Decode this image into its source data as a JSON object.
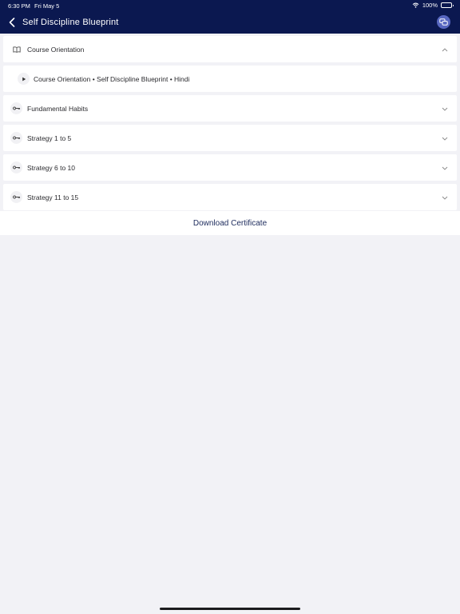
{
  "status_bar": {
    "time": "6:30 PM",
    "date": "Fri May 5",
    "battery": "100%",
    "battery_level": 1.0
  },
  "header": {
    "title": "Self Discipline Blueprint",
    "background": "#0b1850",
    "chat_button_color": "#5867c0"
  },
  "sections": [
    {
      "title": "Course Orientation",
      "icon": "book-icon",
      "expanded": true,
      "lessons": [
        {
          "title": "Course Orientation • Self Discipline Blueprint • Hindi",
          "icon": "play-icon"
        }
      ]
    },
    {
      "title": "Fundamental Habits",
      "icon": "key-icon",
      "expanded": false
    },
    {
      "title": "Strategy 1 to 5",
      "icon": "key-icon",
      "expanded": false
    },
    {
      "title": "Strategy 6 to 10",
      "icon": "key-icon",
      "expanded": false
    },
    {
      "title": "Strategy 11 to 15",
      "icon": "key-icon",
      "expanded": false
    }
  ],
  "footer": {
    "download_certificate": "Download Certificate"
  }
}
